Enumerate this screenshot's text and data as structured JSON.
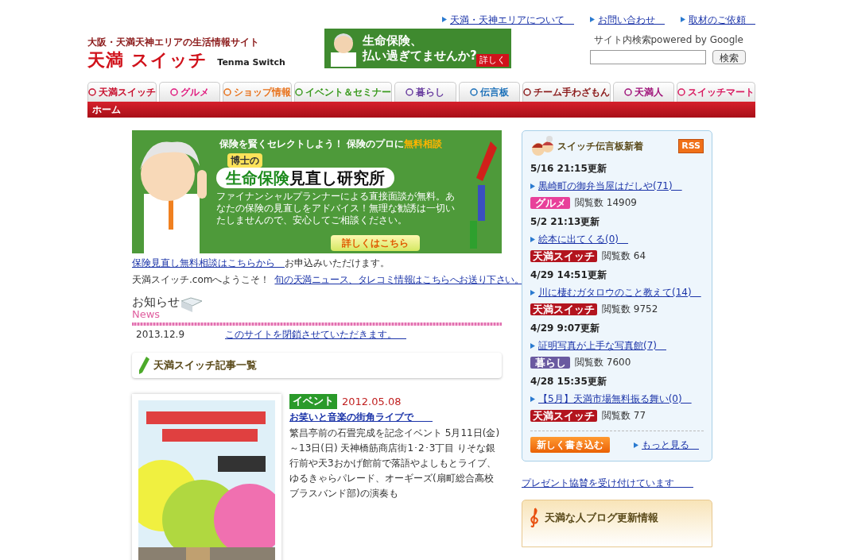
{
  "top_links": [
    "天満・天神エリアについて",
    "お問い合わせ",
    "取材のご依頼"
  ],
  "logo": {
    "tagline": "大阪・天満天神エリアの生活情報サイト",
    "title": "天満 スイッチ",
    "subtitle": "Tenma Switch"
  },
  "header_banner": {
    "headline_1": "生命保険、",
    "headline_2": "払い過ぎてませんか?",
    "button": "詳しく"
  },
  "search": {
    "label": "サイト内検索powered by Google",
    "button": "検索"
  },
  "nav_tabs": [
    {
      "label": "天満スイッチ",
      "color": "#c8102e"
    },
    {
      "label": "グルメ",
      "color": "#e0197d"
    },
    {
      "label": "ショップ情報",
      "color": "#e8711a"
    },
    {
      "label": "イベント＆セミナー",
      "color": "#3a9a1e"
    },
    {
      "label": "暮らし",
      "color": "#6a3fa0"
    },
    {
      "label": "伝言板",
      "color": "#1a6fb8"
    },
    {
      "label": "チーム手わざもん",
      "color": "#8b1a1a"
    },
    {
      "label": "天満人",
      "color": "#a0147a"
    },
    {
      "label": "スイッチマート",
      "color": "#d81b60"
    }
  ],
  "breadcrumb": "ホーム",
  "main_banner": {
    "top": "保険を賢くセレクトしよう！ 保険のプロに",
    "top_highlight": "無料相談",
    "badge": "博士の",
    "title_green": "生命保険",
    "title_black": "見直し研究所",
    "body": "ファイナンシャルプランナーによる直接面談が無料。あなたの保険の見直しをアドバイス！無理な勧誘は一切いたしませんので、安心してご相談ください。",
    "button": "詳しくはこちら"
  },
  "intro": [
    {
      "kind": "link_text",
      "link": "保険見直し無料相談はこちらから",
      "text": "お申込みいただけます。"
    },
    {
      "kind": "text_link",
      "link": "旬の天満ニュース、タレコミ情報はこちらへお送り下さい。",
      "text": "天満スイッチ.comへようこそ！"
    }
  ],
  "news": {
    "title": "お知らせ",
    "subtitle": "News",
    "items": [
      {
        "date": "2013.12.9",
        "text": "このサイトを閉鎖させていただきます。"
      }
    ]
  },
  "articles_heading": "天満スイッチ記事一覧",
  "articles": [
    {
      "kind": "picture",
      "tag": "イベント",
      "date": "2012.05.08",
      "title": "お笑いと音楽の街角ライブで",
      "body": "繁昌亭前の石畳完成を記念イベント  5月11日(金)～13日(日) 天神橋筋商店街1･2･3丁目 りそな銀行前や天3おかげ館前で落語やよしもとライブ、ゆるきゃらパレード、オーギーズ(扇町総合高校ブラスバンド部)の演奏も"
    }
  ],
  "board": {
    "title": "スイッチ伝言板新着",
    "rss": "RSS",
    "posts": [
      {
        "updated": "5/16 21:15更新",
        "title": "黒崎町の御弁当屋はだしや(71)",
        "category": "グルメ",
        "color": "#e8409a",
        "views": "閲覧数 14909"
      },
      {
        "updated": "5/2 21:13更新",
        "title": "絵本に出てくる(0)",
        "category": "天満スイッチ",
        "color": "#b3141e",
        "views": "閲覧数 64"
      },
      {
        "updated": "4/29 14:51更新",
        "title": "川に棲むガタロウのこと教えて(14)",
        "category": "天満スイッチ",
        "color": "#b3141e",
        "views": "閲覧数 9752"
      },
      {
        "updated": "4/29 9:07更新",
        "title": "証明写真が上手な写真館(7)",
        "category": "暮らし",
        "color": "#6a5aa0",
        "views": "閲覧数 7600"
      },
      {
        "updated": "4/28 15:35更新",
        "title": "【5月】天満市場無料振る舞い(0)",
        "category": "天満スイッチ",
        "color": "#b3141e",
        "views": "閲覧数 77"
      }
    ],
    "write_button": "新しく書き込む",
    "more": "もっと見る"
  },
  "present_link": "プレゼント協賛を受け付けています",
  "blog_heading": "天満な人ブログ更新情報"
}
